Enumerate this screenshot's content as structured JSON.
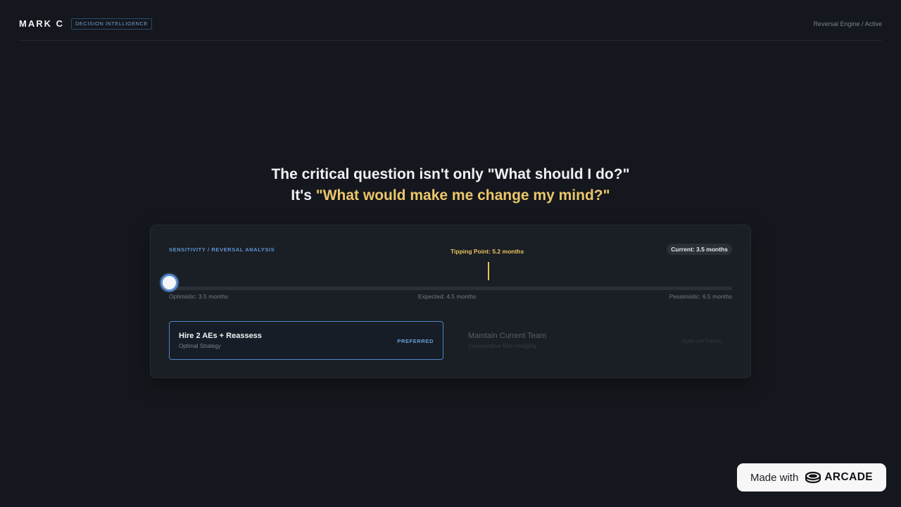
{
  "header": {
    "brand": "MARK C",
    "badge": "DECISION INTELLIGENCE",
    "status": "Reversal Engine / Active"
  },
  "headline": {
    "line1": "The critical question isn't only \"What should I do?\"",
    "line2_prefix": "It's ",
    "line2_accent": "\"What would make me change my mind?\""
  },
  "analysis": {
    "title": "SENSITIVITY / REVERSAL ANALYSIS",
    "tipping_point": "Tipping Point: 5.2 months",
    "current": "Current: 3.5 months",
    "slider_value_months": 3.5,
    "slider_min_months": 3.5,
    "slider_max_months": 6.5,
    "tipping_point_months": 5.2,
    "scale": {
      "optimistic": "Optimistic: 3.5 months",
      "expected": "Expected: 4.5 months",
      "pessimistic": "Pessimistic: 6.5 months"
    },
    "options": [
      {
        "title": "Hire 2 AEs + Reassess",
        "subtitle": "Optimal Strategy",
        "tag": "PREFERRED"
      },
      {
        "title": "Maintain Current Team",
        "subtitle": "Conservative Risk-Hedging",
        "tag": "SUB-OPTIMAL"
      }
    ]
  },
  "footer_badge": {
    "made_with": "Made with",
    "brand": "ARCADE"
  },
  "colors": {
    "background": "#14171d",
    "accent_blue": "#5b8ed0",
    "accent_yellow": "#ecc76a"
  }
}
